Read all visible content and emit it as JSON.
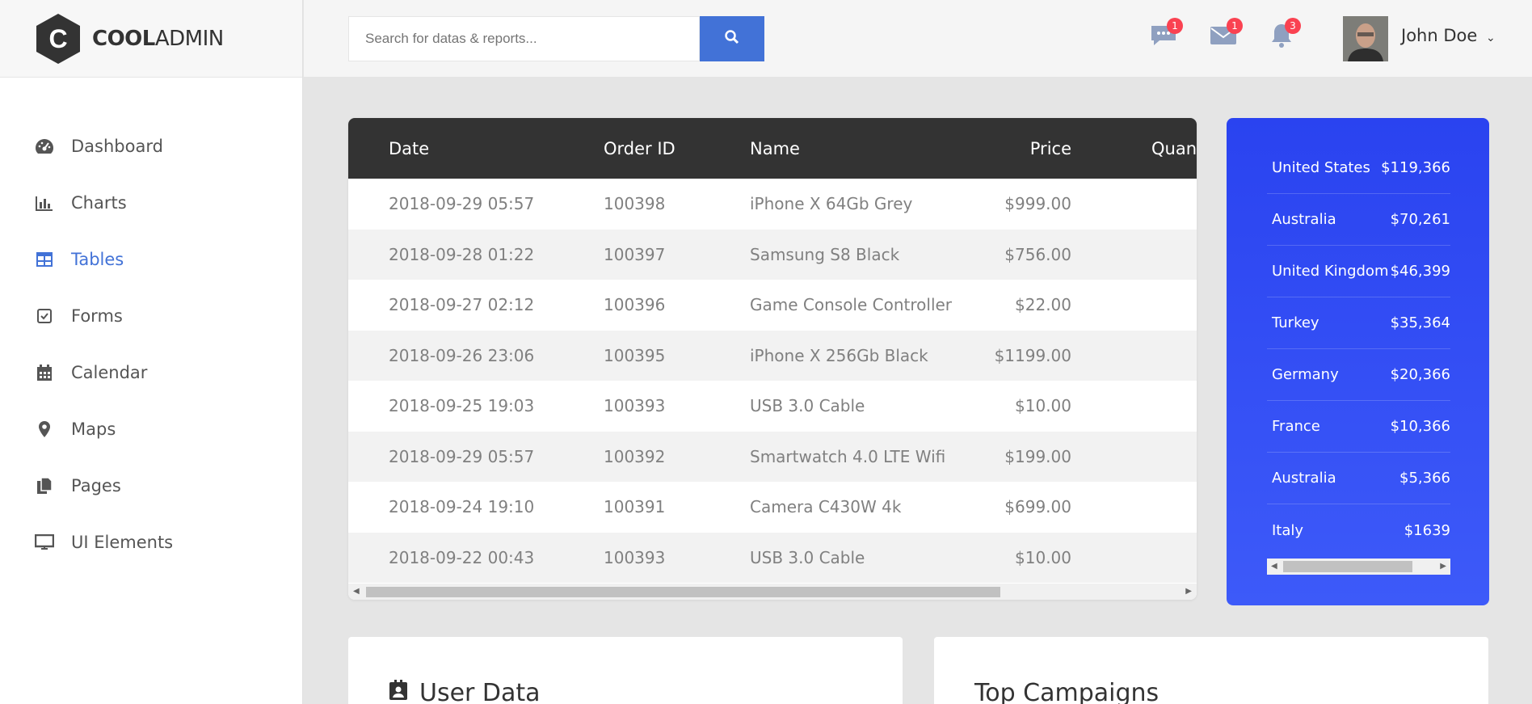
{
  "brand": {
    "bold": "COOL",
    "light": "ADMIN",
    "letter": "C"
  },
  "sidebar": {
    "items": [
      {
        "label": "Dashboard",
        "icon": "dashboard-icon"
      },
      {
        "label": "Charts",
        "icon": "bar-chart-icon"
      },
      {
        "label": "Tables",
        "icon": "table-icon",
        "active": true
      },
      {
        "label": "Forms",
        "icon": "checkbox-icon"
      },
      {
        "label": "Calendar",
        "icon": "calendar-icon"
      },
      {
        "label": "Maps",
        "icon": "map-marker-icon"
      },
      {
        "label": "Pages",
        "icon": "copy-icon"
      },
      {
        "label": "UI Elements",
        "icon": "desktop-icon"
      }
    ]
  },
  "header": {
    "search_placeholder": "Search for datas & reports...",
    "notifications": {
      "comments": "1",
      "mail": "1",
      "bell": "3"
    },
    "user": "John Doe"
  },
  "table": {
    "columns": [
      "Date",
      "Order ID",
      "Name",
      "Price",
      "Quan"
    ],
    "rows": [
      [
        "2018-09-29 05:57",
        "100398",
        "iPhone X 64Gb Grey",
        "$999.00"
      ],
      [
        "2018-09-28 01:22",
        "100397",
        "Samsung S8 Black",
        "$756.00"
      ],
      [
        "2018-09-27 02:12",
        "100396",
        "Game Console Controller",
        "$22.00"
      ],
      [
        "2018-09-26 23:06",
        "100395",
        "iPhone X 256Gb Black",
        "$1199.00"
      ],
      [
        "2018-09-25 19:03",
        "100393",
        "USB 3.0 Cable",
        "$10.00"
      ],
      [
        "2018-09-29 05:57",
        "100392",
        "Smartwatch 4.0 LTE Wifi",
        "$199.00"
      ],
      [
        "2018-09-24 19:10",
        "100391",
        "Camera C430W 4k",
        "$699.00"
      ],
      [
        "2018-09-22 00:43",
        "100393",
        "USB 3.0 Cable",
        "$10.00"
      ]
    ]
  },
  "countries": [
    {
      "name": "United States",
      "value": "$119,366"
    },
    {
      "name": "Australia",
      "value": "$70,261"
    },
    {
      "name": "United Kingdom",
      "value": "$46,399"
    },
    {
      "name": "Turkey",
      "value": "$35,364"
    },
    {
      "name": "Germany",
      "value": "$20,366"
    },
    {
      "name": "France",
      "value": "$10,366"
    },
    {
      "name": "Australia",
      "value": "$5,366"
    },
    {
      "name": "Italy",
      "value": "$1639"
    }
  ],
  "bottom": {
    "user_data_title": "User Data",
    "top_campaigns_title": "Top Campaigns"
  },
  "colors": {
    "accent": "#4272d7",
    "badge": "#fa4251",
    "table_header": "#333333",
    "country_card": "#3149f5"
  }
}
